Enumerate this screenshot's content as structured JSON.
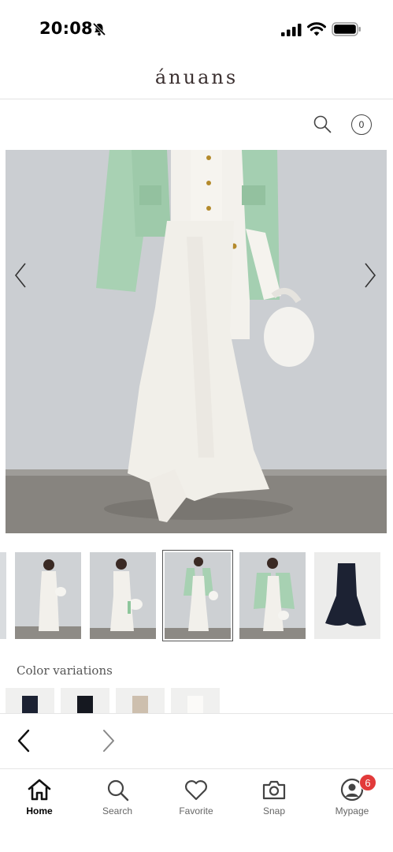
{
  "status_bar": {
    "time": "20:08",
    "icons": [
      "bell-slash-icon",
      "signal-icon",
      "wifi-icon",
      "battery-icon"
    ]
  },
  "header": {
    "brand": "ánuans"
  },
  "toolbar": {
    "search_icon": "search-icon",
    "cart_count": "0"
  },
  "gallery": {
    "thumbnail_count": 5,
    "selected_index": 2,
    "arrows": [
      "chevron-left-icon",
      "chevron-right-icon"
    ]
  },
  "color_variations": {
    "title": "Color variations",
    "swatch_colors": [
      "#1c2233",
      "#151820",
      "#cdbfae",
      "#f2f1ee"
    ]
  },
  "browser_nav": {
    "icons": [
      "back-arrow-icon",
      "forward-arrow-icon"
    ]
  },
  "tab_bar": {
    "items": [
      {
        "label": "Home",
        "icon": "home-icon",
        "active": true
      },
      {
        "label": "Search",
        "icon": "search-icon",
        "active": false
      },
      {
        "label": "Favorite",
        "icon": "heart-icon",
        "active": false
      },
      {
        "label": "Snap",
        "icon": "camera-icon",
        "active": false
      },
      {
        "label": "Mypage",
        "icon": "user-icon",
        "active": false,
        "badge": "6"
      }
    ]
  },
  "colors": {
    "accent_badge": "#e23a3a",
    "jacket_mint": "#a7d1b2",
    "skirt_cream": "#f1efe9"
  }
}
